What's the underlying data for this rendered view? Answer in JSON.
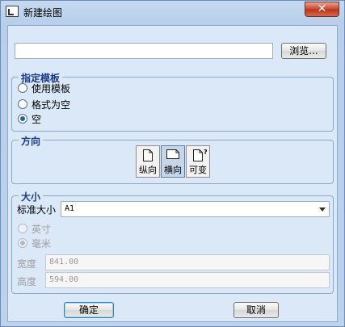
{
  "window": {
    "title": "新建绘图",
    "close_glyph": "✕"
  },
  "name_input": {
    "value": "",
    "placeholder": ""
  },
  "browse_button": "浏览...",
  "template_group": {
    "legend": "指定模板",
    "options": [
      {
        "label": "使用模板",
        "checked": false
      },
      {
        "label": "格式为空",
        "checked": false
      },
      {
        "label": "空",
        "checked": true
      }
    ]
  },
  "orientation_group": {
    "legend": "方向",
    "buttons": [
      {
        "label": "纵向",
        "icon": "portrait-page-icon",
        "pressed": false
      },
      {
        "label": "横向",
        "icon": "landscape-page-icon",
        "pressed": true
      },
      {
        "label": "可变",
        "icon": "variable-page-icon",
        "pressed": false
      }
    ],
    "variable_glyph": "?"
  },
  "size_group": {
    "legend": "大小",
    "standard_label": "标准大小",
    "standard_value": "A1",
    "units": [
      {
        "label": "英寸",
        "checked": false
      },
      {
        "label": "毫米",
        "checked": true
      }
    ],
    "width_label": "宽度",
    "width_value": "841.00",
    "height_label": "高度",
    "height_value": "594.00"
  },
  "ok_button": "确定",
  "cancel_button": "取消"
}
